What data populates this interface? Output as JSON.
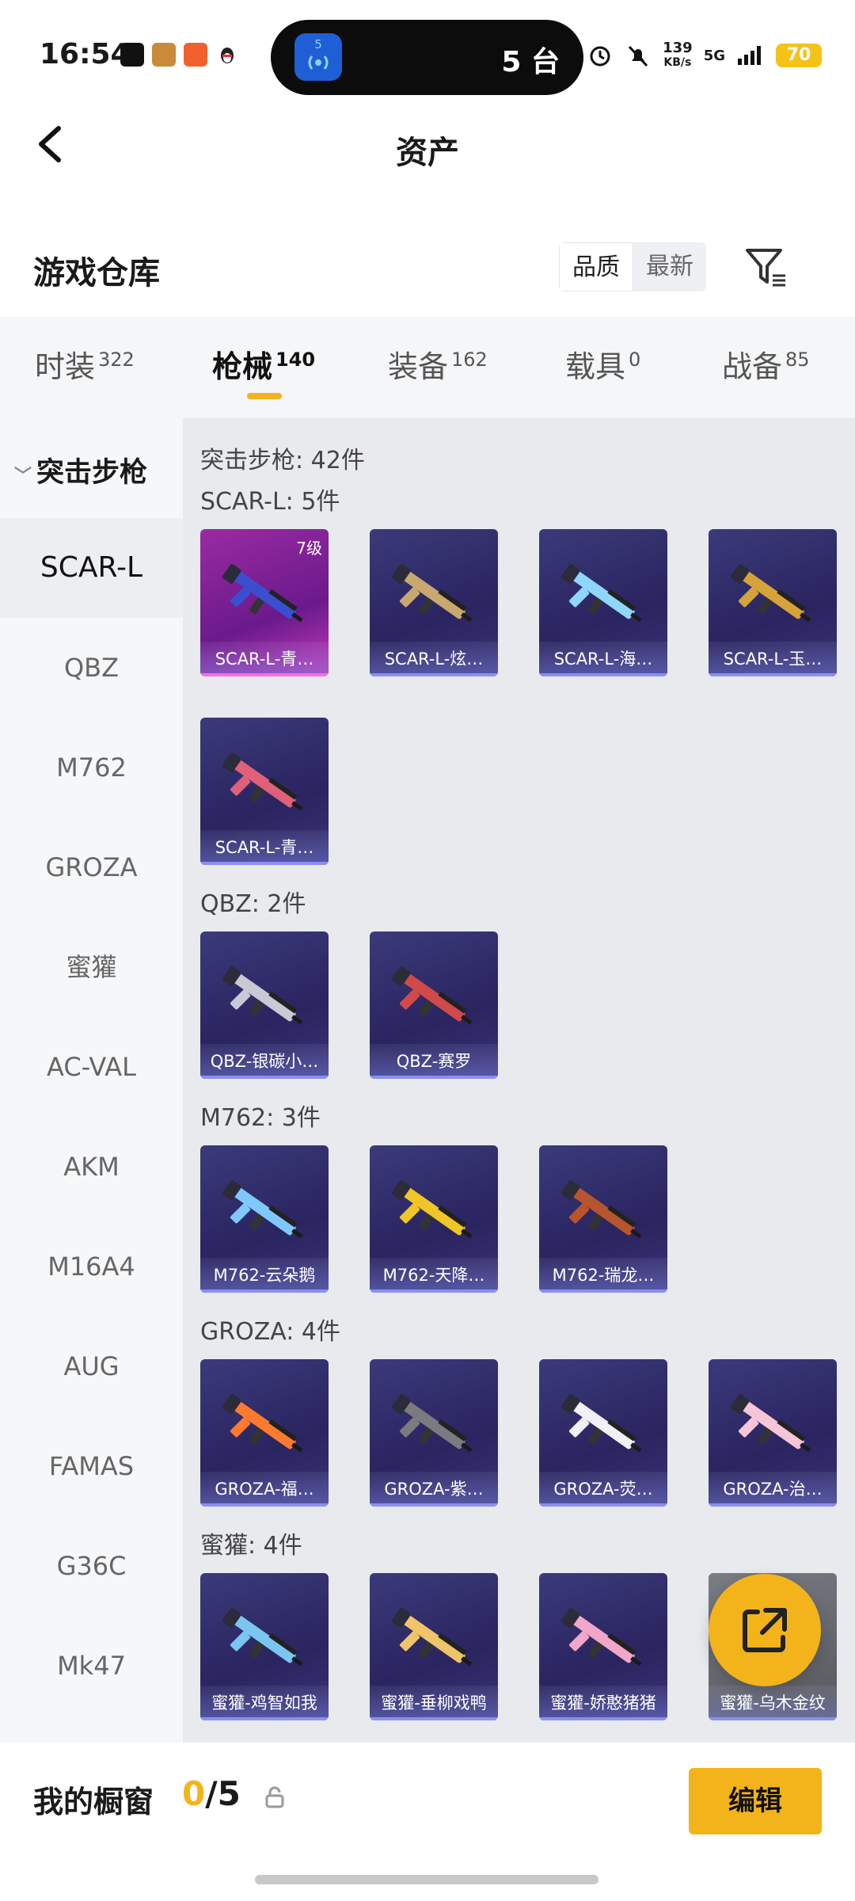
{
  "status_bar": {
    "time": "16:54",
    "island_text": "5 台",
    "island_badge": "5",
    "net_speed_value": "139",
    "net_speed_unit": "KB/s",
    "signal": "5G",
    "battery": "70"
  },
  "header": {
    "title": "资产"
  },
  "warehouse": {
    "title": "游戏仓库",
    "sort_quality": "品质",
    "sort_newest": "最新"
  },
  "tabs": [
    {
      "label": "时装",
      "count": "322"
    },
    {
      "label": "枪械",
      "count": "140"
    },
    {
      "label": "装备",
      "count": "162"
    },
    {
      "label": "载具",
      "count": "0"
    },
    {
      "label": "战备",
      "count": "85"
    }
  ],
  "sidebar": {
    "category": "突击步枪",
    "items": [
      "SCAR-L",
      "QBZ",
      "M762",
      "GROZA",
      "蜜獾",
      "AC-VAL",
      "AKM",
      "M16A4",
      "AUG",
      "FAMAS",
      "G36C",
      "Mk47"
    ]
  },
  "content": {
    "total": "突击步枪: 42件",
    "sections": [
      {
        "title": "SCAR-L: 5件",
        "items": [
          {
            "label": "SCAR-L-青…",
            "level": "7级",
            "gun_color": "#3a4fd0"
          },
          {
            "label": "SCAR-L-炫…",
            "gun_color": "#c9a870"
          },
          {
            "label": "SCAR-L-海…",
            "gun_color": "#8fd6ff"
          },
          {
            "label": "SCAR-L-玉…",
            "gun_color": "#d6a23a"
          },
          {
            "label": "SCAR-L-青…",
            "gun_color": "#e0607a"
          }
        ]
      },
      {
        "title": "QBZ: 2件",
        "items": [
          {
            "label": "QBZ-银碳小…",
            "gun_color": "#c9c9d6"
          },
          {
            "label": "QBZ-赛罗",
            "gun_color": "#d04a4a"
          }
        ]
      },
      {
        "title": "M762: 3件",
        "items": [
          {
            "label": "M762-云朵鹅",
            "gun_color": "#7fc8ff"
          },
          {
            "label": "M762-天降…",
            "gun_color": "#f0c528"
          },
          {
            "label": "M762-瑞龙…",
            "gun_color": "#b8552e"
          }
        ]
      },
      {
        "title": "GROZA: 4件",
        "items": [
          {
            "label": "GROZA-福…",
            "gun_color": "#ff7a2e"
          },
          {
            "label": "GROZA-紫…",
            "gun_color": "#7a7a80"
          },
          {
            "label": "GROZA-荧…",
            "gun_color": "#f0f0f5"
          },
          {
            "label": "GROZA-治…",
            "gun_color": "#f6c5d8"
          }
        ]
      },
      {
        "title": "蜜獾: 4件",
        "items": [
          {
            "label": "蜜獾-鸡智如我",
            "gun_color": "#7bc6f0"
          },
          {
            "label": "蜜獾-垂柳戏鸭",
            "gun_color": "#f0c46a"
          },
          {
            "label": "蜜獾-娇憨猪猪",
            "gun_color": "#f2a6c8"
          },
          {
            "label": "蜜獾-乌木金纹",
            "gun_color": "#b08a3a"
          }
        ]
      }
    ]
  },
  "bottom_bar": {
    "title": "我的橱窗",
    "count_current": "0",
    "count_sep": "/5",
    "edit_label": "编辑"
  },
  "colors": {
    "accent": "#f3b31b",
    "card_bg": "#2a2460",
    "highlight_card": "#9b2aa2"
  }
}
